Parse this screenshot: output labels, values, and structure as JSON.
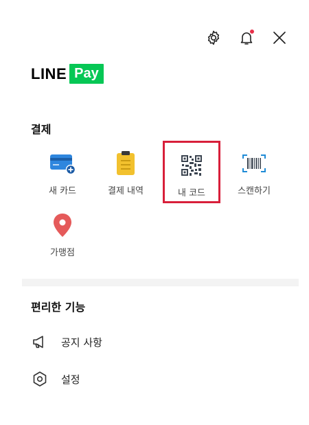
{
  "header": {
    "settings_icon": "gear-icon",
    "notifications_icon": "bell-icon",
    "close_icon": "close-icon",
    "notification_dot_color": "#e8304a"
  },
  "logo": {
    "line": "LINE",
    "pay": "Pay",
    "pay_color": "#06c755"
  },
  "payment": {
    "title": "결제",
    "items": [
      {
        "label": "새 카드",
        "icon": "card-add-icon"
      },
      {
        "label": "결제 내역",
        "icon": "clipboard-icon"
      },
      {
        "label": "내 코드",
        "icon": "qr-code-icon",
        "highlighted": true
      },
      {
        "label": "스캔하기",
        "icon": "barcode-scan-icon"
      },
      {
        "label": "가맹점",
        "icon": "location-pin-icon"
      }
    ]
  },
  "features": {
    "title": "편리한 기능",
    "items": [
      {
        "label": "공지 사항",
        "icon": "megaphone-icon"
      },
      {
        "label": "설정",
        "icon": "settings-hexagon-icon"
      }
    ]
  }
}
